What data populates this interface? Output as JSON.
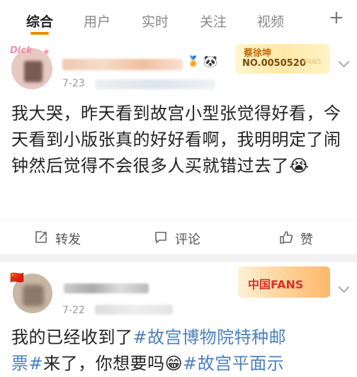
{
  "tabs": [
    {
      "label": "综合",
      "active": true
    },
    {
      "label": "用户",
      "active": false
    },
    {
      "label": "实时",
      "active": false
    },
    {
      "label": "关注",
      "active": false
    },
    {
      "label": "视频",
      "active": false
    }
  ],
  "plus_label": "+",
  "posts": [
    {
      "avatar_text": "Dick",
      "date": "7-23",
      "badge": {
        "name": "蔡徐坤",
        "number": "NO.0050520",
        "fans": "FANS"
      },
      "content": "我大哭，昨天看到故宫小型张觉得好看，今天看到小版张真的好好看啊，我明明定了闹钟然后觉得不会很多人买就错过去了",
      "emoji": "😭",
      "actions": {
        "repost": "转发",
        "comment": "评论",
        "like": "赞"
      }
    },
    {
      "date": "7-22",
      "badge": {
        "text": "中国FANS"
      },
      "content_lines": [
        [
          "我的已经收到了",
          "#故宫博物院特种邮"
        ],
        [
          "票#",
          "来了，你想要吗",
          "😁",
          "#故宫平面示"
        ]
      ]
    }
  ],
  "colors": {
    "accent": "#f08a00",
    "link": "#4b7fbd",
    "separator": "#f2f2f2"
  }
}
